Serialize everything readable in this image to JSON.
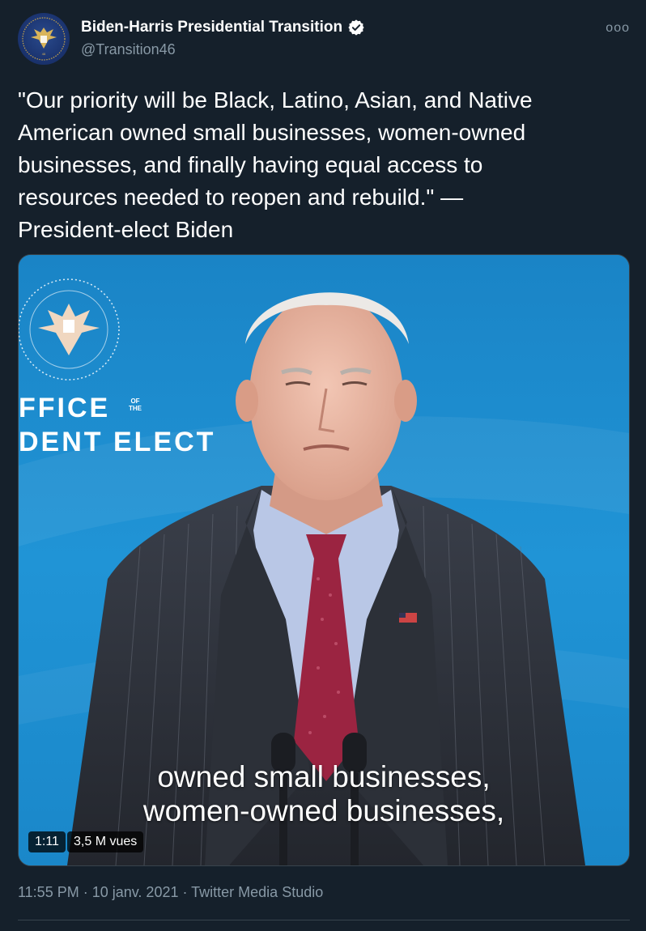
{
  "author": {
    "display_name": "Biden-Harris Presidential Transition",
    "handle": "@Transition46",
    "verified_icon": "verified-badge-icon",
    "avatar_icon": "presidential-seal-icon"
  },
  "more_label": "ooo",
  "tweet": {
    "text": "\"Our priority will be Black, Latino, Asian, and Native\nAmerican owned small businesses, women-owned\nbusinesses, and finally having equal access to\nresources needed to reopen and rebuild.\" —\nPresident-elect Biden"
  },
  "media": {
    "backdrop_line1": "FFICE",
    "backdrop_ofthe": "OF\nTHE",
    "backdrop_line2": "DENT ELECT",
    "caption_line1": "owned small businesses,",
    "caption_line2": "women-owned businesses,",
    "duration": "1:11",
    "views": "3,5 M vues"
  },
  "meta": {
    "time": "11:55 PM",
    "sep1": " · ",
    "date": "10 janv. 2021",
    "sep2": " · ",
    "source": "Twitter Media Studio"
  },
  "colors": {
    "background": "#15202b",
    "secondary_text": "#8899a6",
    "verified": "#ffffff",
    "media_blue": "#1e8fd3"
  }
}
